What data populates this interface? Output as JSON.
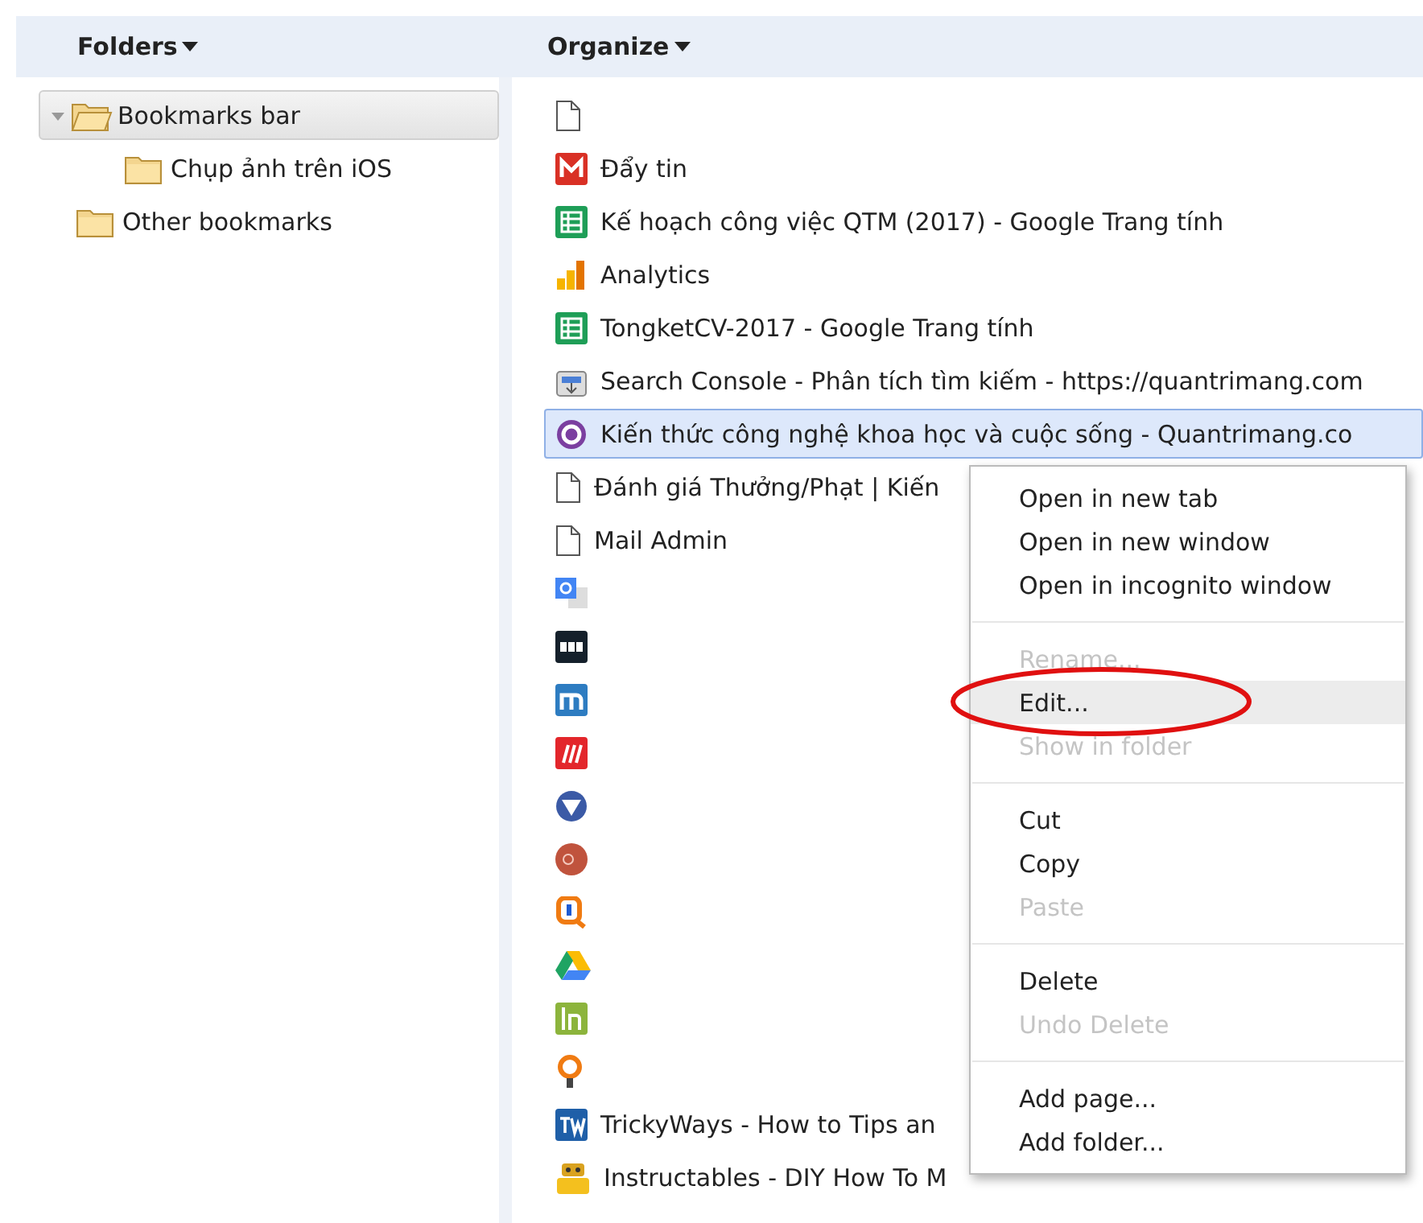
{
  "header": {
    "folders_menu": "Folders",
    "organize_menu": "Organize"
  },
  "folders": [
    {
      "label": "Bookmarks bar",
      "expanded": true,
      "selected": true,
      "children": [
        {
          "label": "Chụp ảnh trên iOS",
          "selected": false
        }
      ]
    },
    {
      "label": "Other bookmarks",
      "selected": false
    }
  ],
  "bookmarks": [
    {
      "kind": "page",
      "selected": false
    },
    {
      "kind": "gmail",
      "title": "Đẩy tin",
      "selected": false
    },
    {
      "kind": "sheets",
      "title": "Kế hoạch công việc QTM (2017) - Google Trang tính",
      "selected": false
    },
    {
      "kind": "analytics",
      "title": "Analytics",
      "selected": false
    },
    {
      "kind": "sheets",
      "title": "TongketCV-2017 - Google Trang tính",
      "selected": false
    },
    {
      "kind": "console",
      "title": "Search Console - Phân tích tìm kiếm - https://quantrimang.com",
      "selected": false
    },
    {
      "kind": "qtm",
      "title": "Kiến thức công nghệ khoa học và cuộc sống - Quantrimang.co",
      "selected": true
    },
    {
      "kind": "page",
      "title": "Đánh giá Thưởng/Phạt | Kiến",
      "selected": false
    },
    {
      "kind": "page",
      "title": "Mail Admin",
      "selected": false
    },
    {
      "kind": "translate",
      "selected": false
    },
    {
      "kind": "htg",
      "selected": false
    },
    {
      "kind": "m",
      "selected": false
    },
    {
      "kind": "redm",
      "selected": false
    },
    {
      "kind": "tv",
      "selected": false
    },
    {
      "kind": "gp",
      "selected": false
    },
    {
      "kind": "q",
      "selected": false
    },
    {
      "kind": "drive",
      "selected": false
    },
    {
      "kind": "lh",
      "selected": false
    },
    {
      "kind": "pin",
      "selected": false
    },
    {
      "kind": "tw",
      "title": "TrickyWays - How to Tips an",
      "selected": false
    },
    {
      "kind": "robot",
      "title": "Instructables - DIY How To M",
      "selected": false
    }
  ],
  "context_menu": {
    "groups": [
      [
        {
          "label": "Open in new tab",
          "disabled": false,
          "selected": false
        },
        {
          "label": "Open in new window",
          "disabled": false,
          "selected": false
        },
        {
          "label": "Open in incognito window",
          "disabled": false,
          "selected": false
        }
      ],
      [
        {
          "label": "Rename...",
          "disabled": true,
          "selected": false
        },
        {
          "label": "Edit...",
          "disabled": false,
          "selected": true,
          "circled": true
        },
        {
          "label": "Show in folder",
          "disabled": true,
          "selected": false
        }
      ],
      [
        {
          "label": "Cut",
          "disabled": false,
          "selected": false
        },
        {
          "label": "Copy",
          "disabled": false,
          "selected": false
        },
        {
          "label": "Paste",
          "disabled": true,
          "selected": false
        }
      ],
      [
        {
          "label": "Delete",
          "disabled": false,
          "selected": false
        },
        {
          "label": "Undo Delete",
          "disabled": true,
          "selected": false
        }
      ],
      [
        {
          "label": "Add page...",
          "disabled": false,
          "selected": false
        },
        {
          "label": "Add folder...",
          "disabled": false,
          "selected": false
        }
      ]
    ]
  }
}
